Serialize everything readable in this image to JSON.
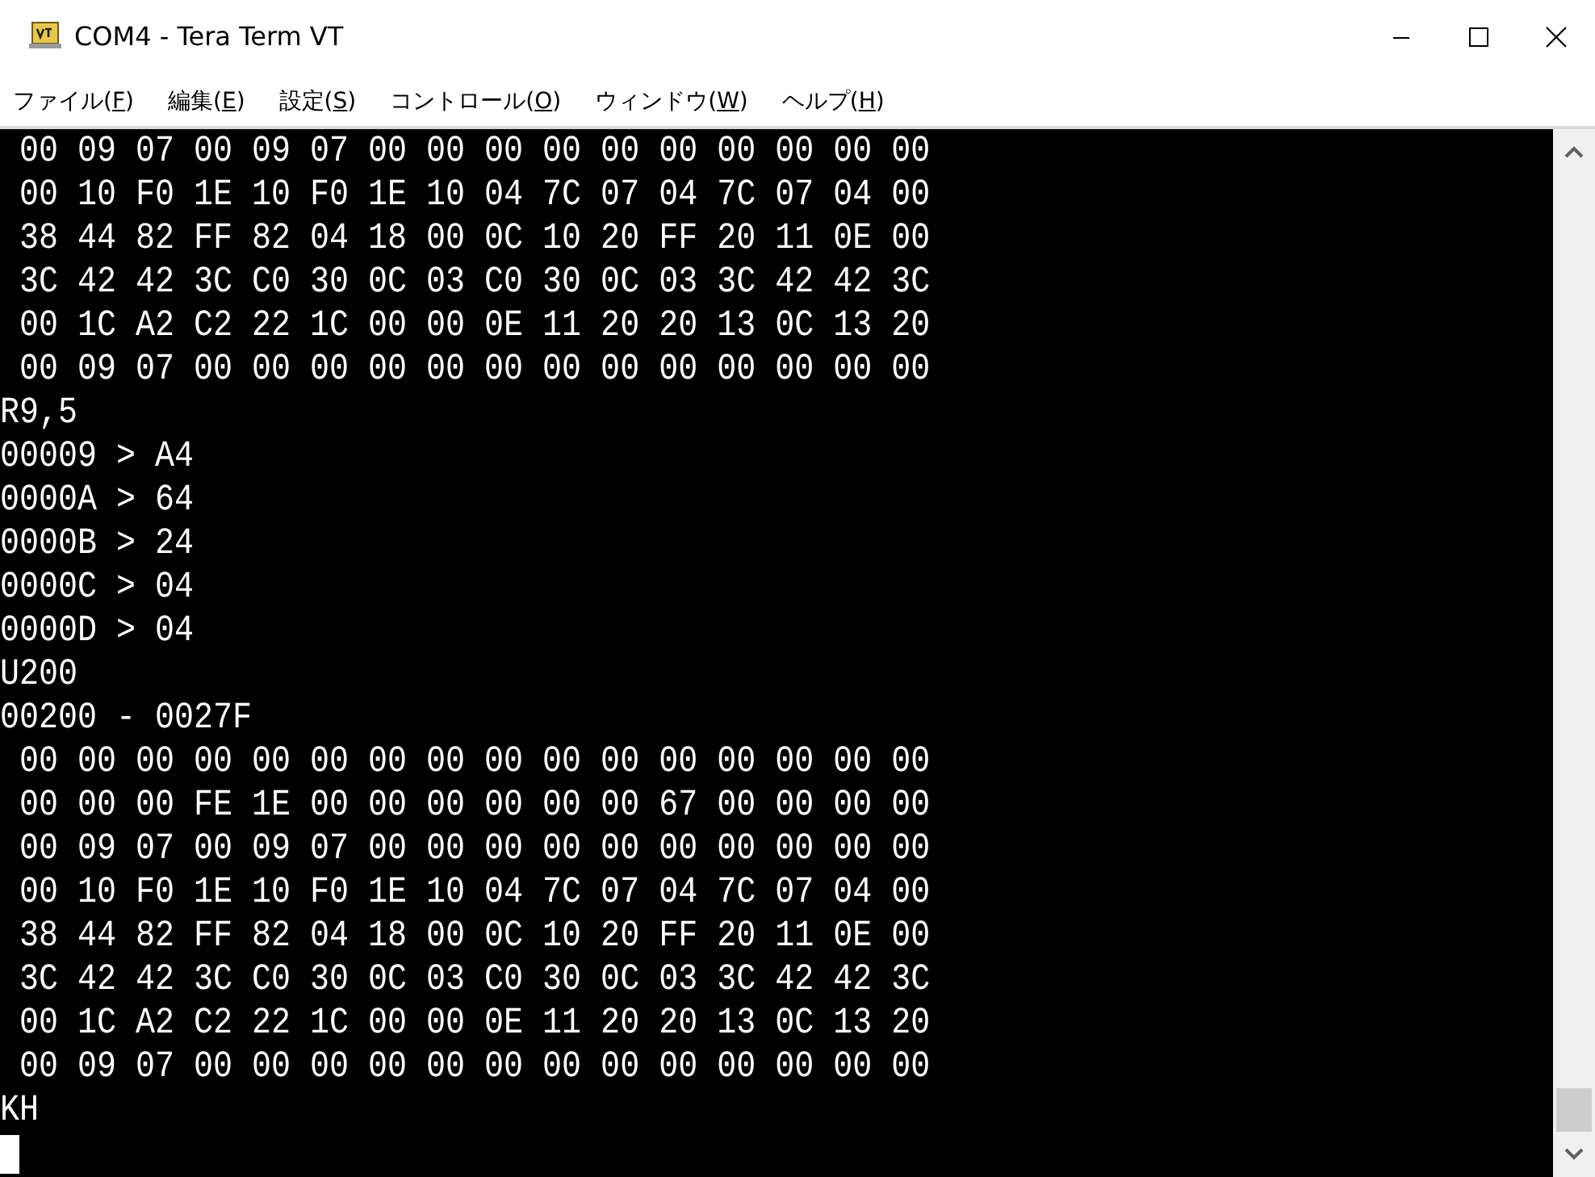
{
  "window": {
    "title": "COM4 - Tera Term VT"
  },
  "menu": [
    {
      "text": "ファイル(",
      "hotkey": "F",
      "tail": ")"
    },
    {
      "text": "編集(",
      "hotkey": "E",
      "tail": ")"
    },
    {
      "text": "設定(",
      "hotkey": "S",
      "tail": ")"
    },
    {
      "text": "コントロール(",
      "hotkey": "O",
      "tail": ")"
    },
    {
      "text": "ウィンドウ(",
      "hotkey": "W",
      "tail": ")"
    },
    {
      "text": "ヘルプ(",
      "hotkey": "H",
      "tail": ")"
    }
  ],
  "terminal": {
    "lines": [
      " 00 09 07 00 09 07 00 00 00 00 00 00 00 00 00 00",
      " 00 10 F0 1E 10 F0 1E 10 04 7C 07 04 7C 07 04 00",
      " 38 44 82 FF 82 04 18 00 0C 10 20 FF 20 11 0E 00",
      " 3C 42 42 3C C0 30 0C 03 C0 30 0C 03 3C 42 42 3C",
      " 00 1C A2 C2 22 1C 00 00 0E 11 20 20 13 0C 13 20",
      " 00 09 07 00 00 00 00 00 00 00 00 00 00 00 00 00",
      "R9,5",
      "00009 > A4",
      "0000A > 64",
      "0000B > 24",
      "0000C > 04",
      "0000D > 04",
      "U200",
      "00200 - 0027F",
      " 00 00 00 00 00 00 00 00 00 00 00 00 00 00 00 00",
      " 00 00 00 FE 1E 00 00 00 00 00 00 67 00 00 00 00",
      " 00 09 07 00 09 07 00 00 00 00 00 00 00 00 00 00",
      " 00 10 F0 1E 10 F0 1E 10 04 7C 07 04 7C 07 04 00",
      " 38 44 82 FF 82 04 18 00 0C 10 20 FF 20 11 0E 00",
      " 3C 42 42 3C C0 30 0C 03 C0 30 0C 03 3C 42 42 3C",
      " 00 1C A2 C2 22 1C 00 00 0E 11 20 20 13 0C 13 20",
      " 00 09 07 00 00 00 00 00 00 00 00 00 00 00 00 00",
      "KH"
    ]
  }
}
